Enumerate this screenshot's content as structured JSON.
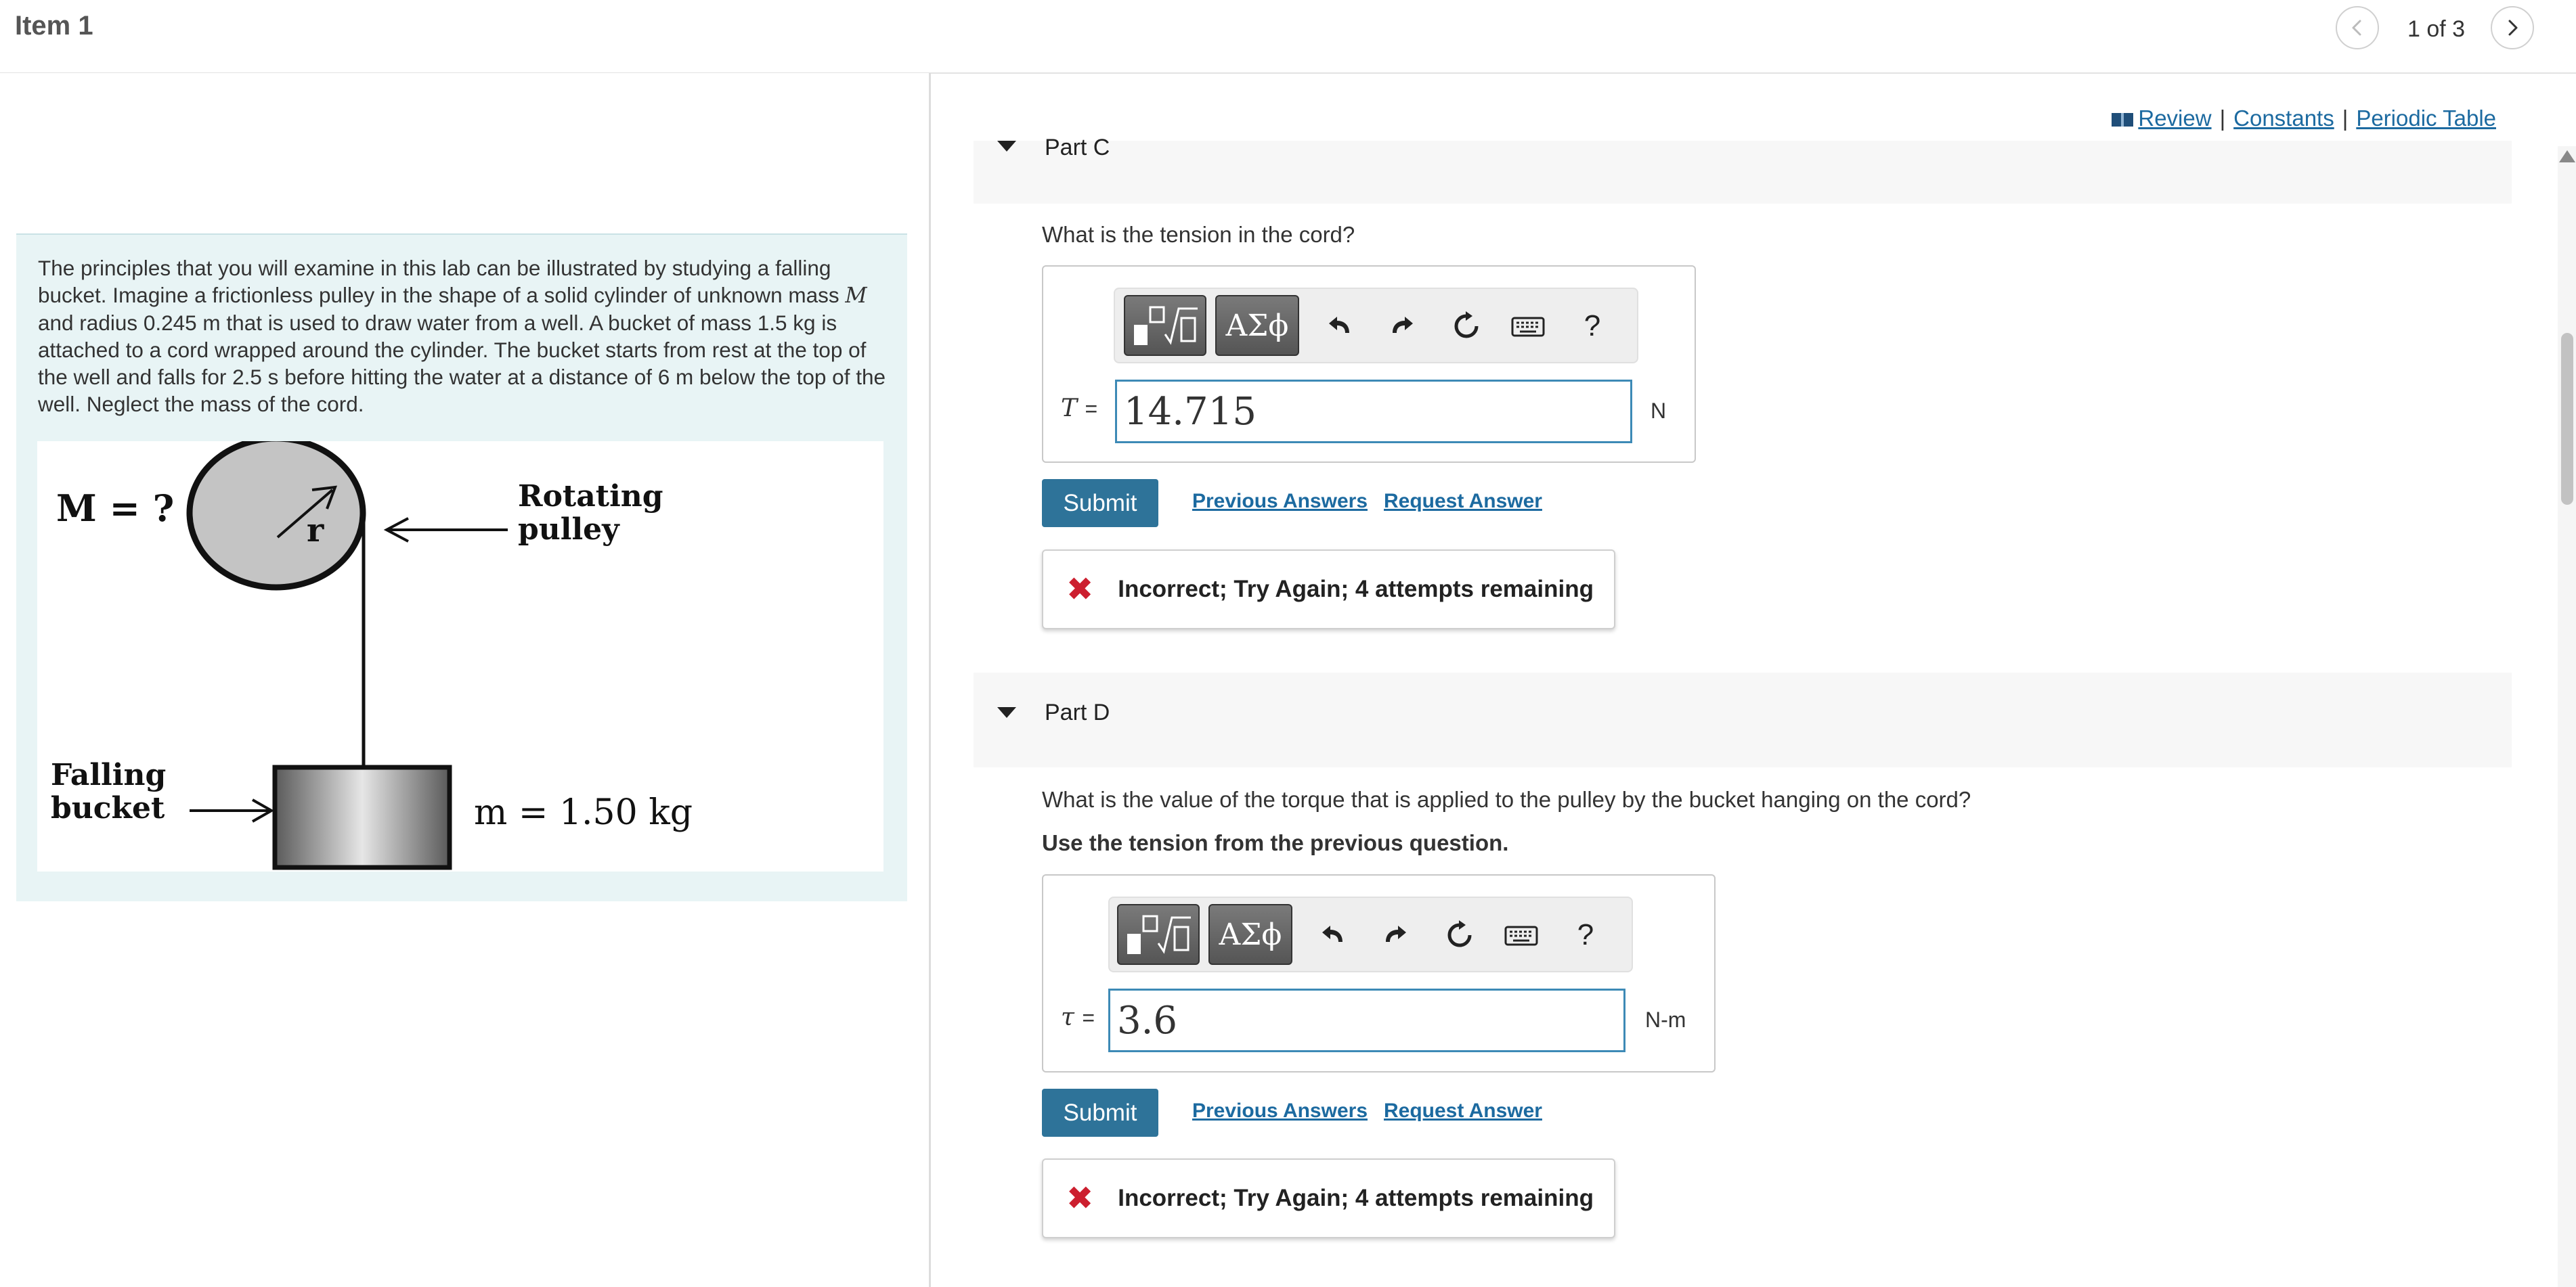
{
  "header": {
    "title": "Item 1",
    "counter": "1 of 3"
  },
  "links": {
    "review": "Review",
    "constants": "Constants",
    "periodic_table": "Periodic Table",
    "separator": "|"
  },
  "problem": {
    "text_before": "The principles that you will examine in this lab can be illustrated by studying a falling bucket. Imagine a frictionless pulley in the shape of a solid cylinder of unknown mass ",
    "mass_symbol": "M",
    "text_after": " and radius 0.245 m that is used to draw water from a well. A bucket of mass 1.5 kg is attached to a cord wrapped around the cylinder. The bucket starts from rest at the top of the well and falls for 2.5 s before hitting the water at a distance of 6 m below the top of the well. Neglect the mass of the cord.",
    "figure": {
      "mass_label": "M = ?",
      "radius_label": "r",
      "pulley_label_line1": "Rotating",
      "pulley_label_line2": "pulley",
      "bucket_label_line1": "Falling",
      "bucket_label_line2": "bucket",
      "bucket_mass_label": "m = 1.50 kg"
    }
  },
  "parts": {
    "c": {
      "title": "Part C",
      "question": "What is the tension in the cord?",
      "variable": "T",
      "equals": "=",
      "value": "14.715",
      "unit": "N",
      "submit": "Submit",
      "previous_answers": "Previous Answers",
      "request_answer": "Request Answer",
      "feedback": "Incorrect; Try Again; 4 attempts remaining"
    },
    "d": {
      "title": "Part D",
      "question": "What is the value of the torque that is applied to the pulley by the bucket hanging on the cord?",
      "instruction": "Use the tension from the previous question.",
      "variable": "τ",
      "equals": "=",
      "value": "3.6",
      "unit": "N-m",
      "submit": "Submit",
      "previous_answers": "Previous Answers",
      "request_answer": "Request Answer",
      "feedback": "Incorrect; Try Again; 4 attempts remaining"
    }
  },
  "toolbar": {
    "greek": "ΑΣϕ",
    "help": "?"
  },
  "icons": {
    "prev": "chevron-left-icon",
    "next": "chevron-right-icon",
    "review": "book-icon",
    "incorrect": "x-icon",
    "collapse": "caret-down-icon"
  },
  "colors": {
    "link": "#1c6aa0",
    "submit": "#2e7399",
    "incorrect": "#cc1f2f",
    "input_border": "#3d8ab6",
    "problem_bg": "#e8f4f5"
  }
}
